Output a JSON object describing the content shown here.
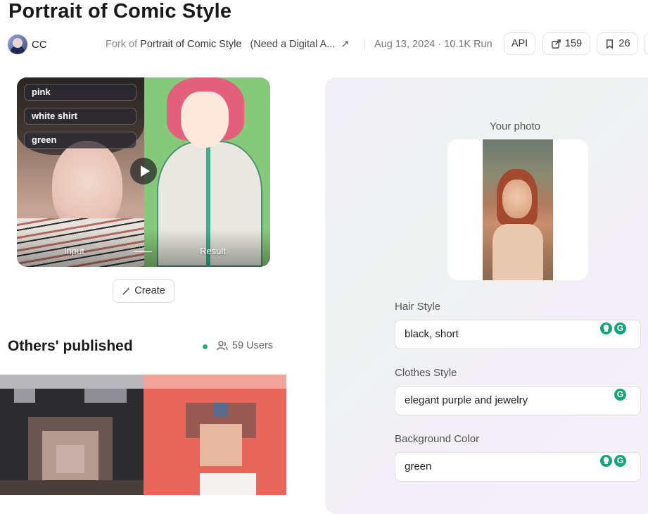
{
  "header": {
    "title": "Portrait of Comic Style",
    "author": "CC",
    "fork_prefix": "Fork of",
    "fork_name": "Portrait of Comic Style",
    "fork_desc": "(Need a Digital A...",
    "fork_link_icon": "external-arrow-icon",
    "meta": "Aug 13, 2024 · 10.1K Run",
    "api_label": "API",
    "share_count": "159",
    "bookmark_count": "26"
  },
  "hero": {
    "tags": [
      "pink",
      "white shirt",
      "green"
    ],
    "input_label": "Input",
    "result_label": "Result",
    "play_icon": "play-icon"
  },
  "create_label": "Create",
  "others": {
    "title": "Others' published",
    "users": "59 Users"
  },
  "form": {
    "photo_label": "Your photo",
    "fields": [
      {
        "label": "Hair Style",
        "value": "black, short"
      },
      {
        "label": "Clothes Style",
        "value": "elegant purple and jewelry"
      },
      {
        "label": "Background Color",
        "value": "green"
      }
    ]
  },
  "colors": {
    "accent_green": "#15a57a",
    "status_dot": "#2db37a"
  }
}
